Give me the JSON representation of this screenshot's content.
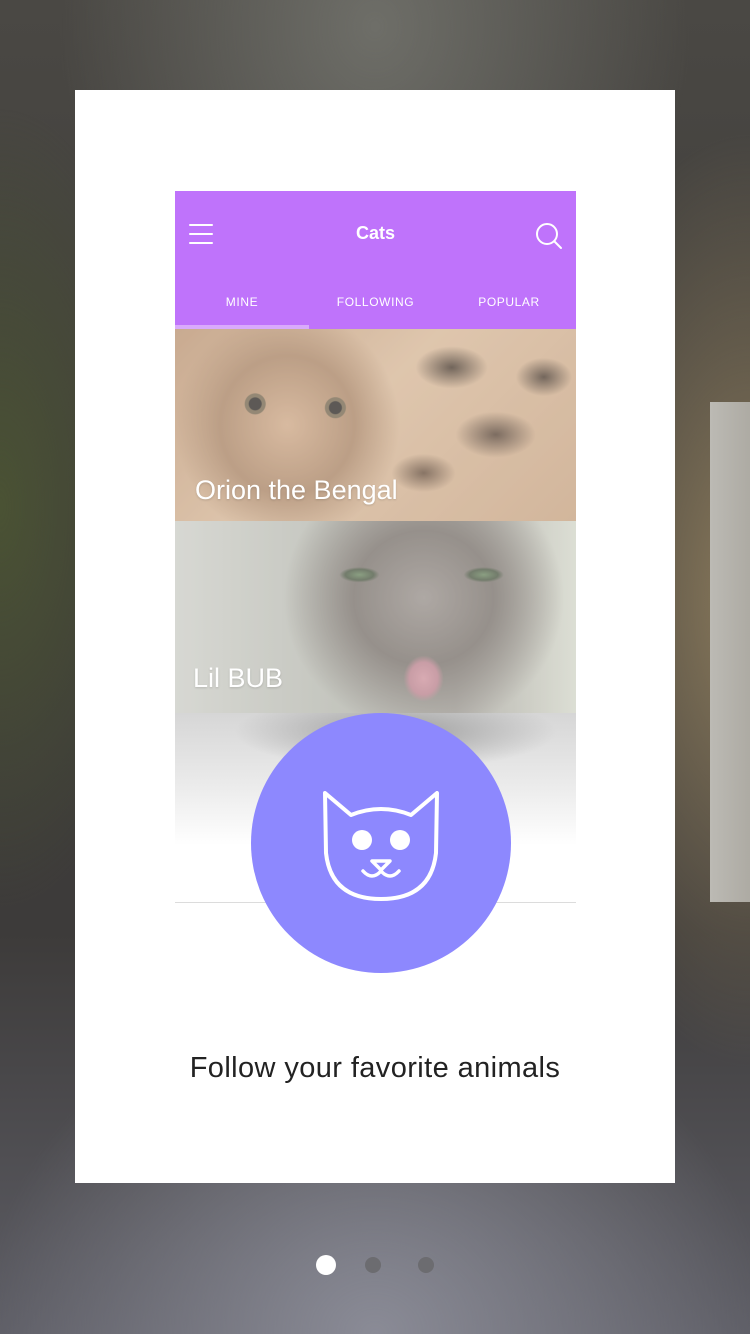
{
  "app": {
    "title": "Cats",
    "accent_color": "#bf73fb",
    "menu_icon": "hamburger-menu-icon",
    "search_icon": "search-icon"
  },
  "tabs": [
    {
      "label": "MINE",
      "active": true
    },
    {
      "label": "FOLLOWING",
      "active": false
    },
    {
      "label": "POPULAR",
      "active": false
    }
  ],
  "feed": [
    {
      "label": "Orion the Bengal"
    },
    {
      "label": "Lil BUB"
    },
    {
      "label": ""
    }
  ],
  "badge": {
    "icon": "cat-face-icon",
    "color": "#8d88fe"
  },
  "onboarding": {
    "caption": "Follow your favorite animals",
    "page_count": 3,
    "current_page": 1
  }
}
